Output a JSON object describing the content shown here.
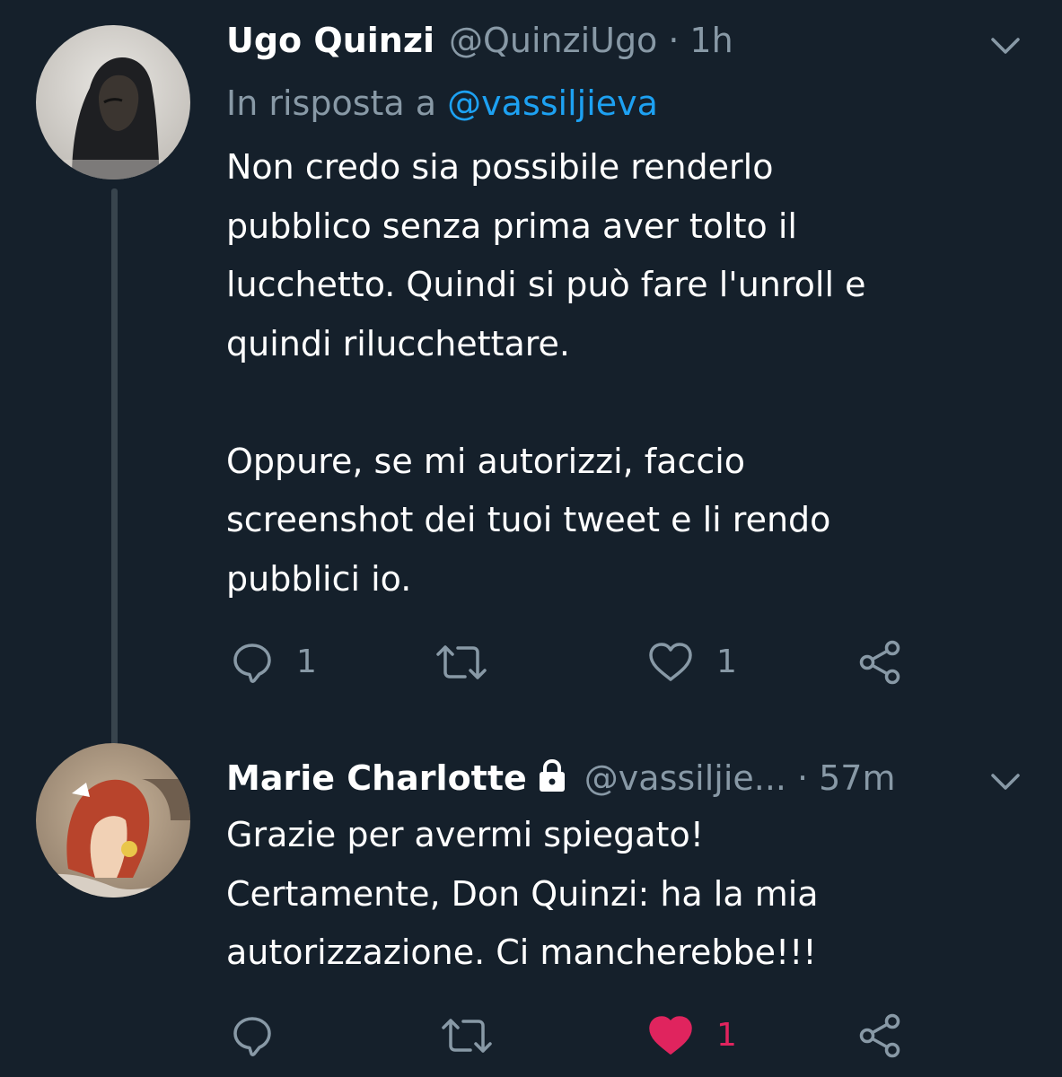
{
  "colors": {
    "background": "#15202b",
    "text_primary": "#ffffff",
    "text_secondary": "#8899a6",
    "link": "#1da1f2",
    "liked": "#e0245e",
    "thread_line": "#38444d"
  },
  "tweets": [
    {
      "name": "Ugo Quinzi",
      "handle": "@QuinziUgo",
      "separator": "·",
      "time": "1h",
      "reply_prefix": "In risposta a",
      "reply_mention": "@vassiljieva",
      "text": "Non credo sia possibile renderlo\npubblico senza prima aver tolto il\nlucchetto. Quindi si può fare l'unroll e\nquindi rilucchettare.\n\nOppure, se mi autorizzi, faccio\nscreenshot dei tuoi tweet e li rendo\npubblici io.",
      "replies": "1",
      "retweets": "",
      "likes": "1",
      "liked": false,
      "avatar_icon": "hooded-person-avatar"
    },
    {
      "name": "Marie Charlotte",
      "protected_icon": "lock-icon",
      "handle": "@vassiljie...",
      "separator": "·",
      "time": "57m",
      "text": "Grazie per avermi spiegato!\nCertamente, Don Quinzi: ha la mia\nautorizzazione. Ci mancherebbe!!!",
      "replies": "",
      "retweets": "",
      "likes": "1",
      "liked": true,
      "avatar_icon": "cartoon-girl-avatar"
    }
  ],
  "icons": {
    "reply": "reply-bubble-icon",
    "retweet": "retweet-icon",
    "like": "heart-icon",
    "share": "share-icon",
    "menu": "chevron-down-icon"
  }
}
